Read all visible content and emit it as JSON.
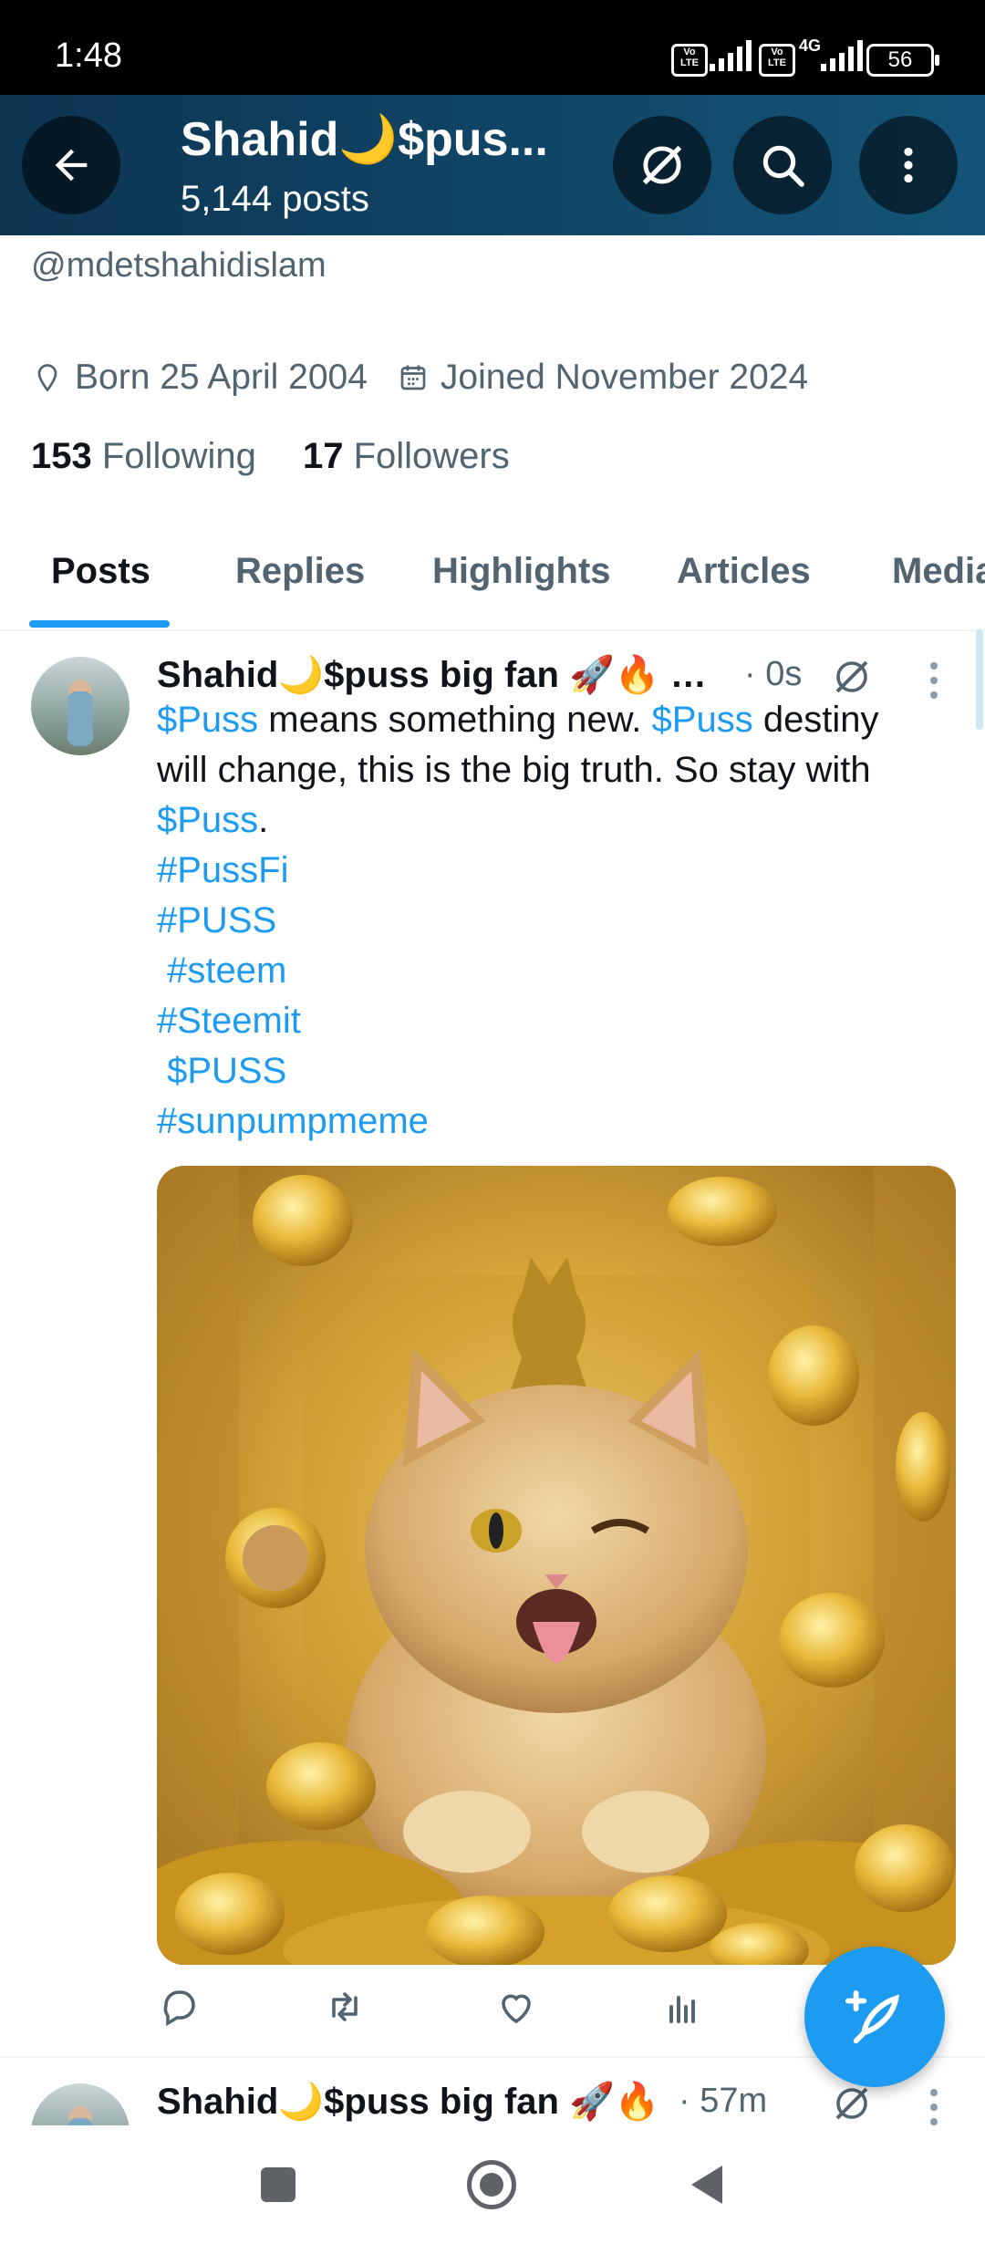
{
  "status_bar": {
    "time": "1:48",
    "network": "4G",
    "battery": "56",
    "volte": "Vo LTE"
  },
  "header": {
    "title": "Shahid🌙$pus...",
    "subtitle": "5,144 posts"
  },
  "profile": {
    "handle": "@mdetshahidislam",
    "born": "Born 25 April 2004",
    "joined": "Joined November 2024",
    "following_count": "153",
    "following_label": "Following",
    "followers_count": "17",
    "followers_label": "Followers"
  },
  "tabs": [
    "Posts",
    "Replies",
    "Highlights",
    "Articles",
    "Media"
  ],
  "posts": [
    {
      "author": "Shahid🌙$puss big fan 🚀🔥 …",
      "time": "· 0s",
      "text_parts": {
        "l1a": "$Puss",
        "l1b": " means something new. ",
        "l1c": "$Puss",
        "l1d": " destiny",
        "l2": "will change, this is the big truth. So stay with",
        "l3a": "$Puss",
        "l3b": ".",
        "tags": [
          "#PussFi",
          "#PUSS",
          " #steem",
          "#Steemit",
          " $PUSS",
          "#sunpumpmeme"
        ]
      }
    },
    {
      "author": "Shahid🌙$puss big fan 🚀🔥",
      "time": "· 57m"
    }
  ],
  "icons": [
    "back-arrow-icon",
    "grok-icon",
    "search-icon",
    "more-vertical-icon",
    "location-pin-icon",
    "calendar-icon",
    "reply-icon",
    "repost-icon",
    "like-icon",
    "views-icon",
    "compose-icon"
  ],
  "colors": {
    "accent": "#1d9bf0",
    "header_bg": "#0d3552",
    "text": "#0f1419",
    "secondary": "#536471"
  }
}
